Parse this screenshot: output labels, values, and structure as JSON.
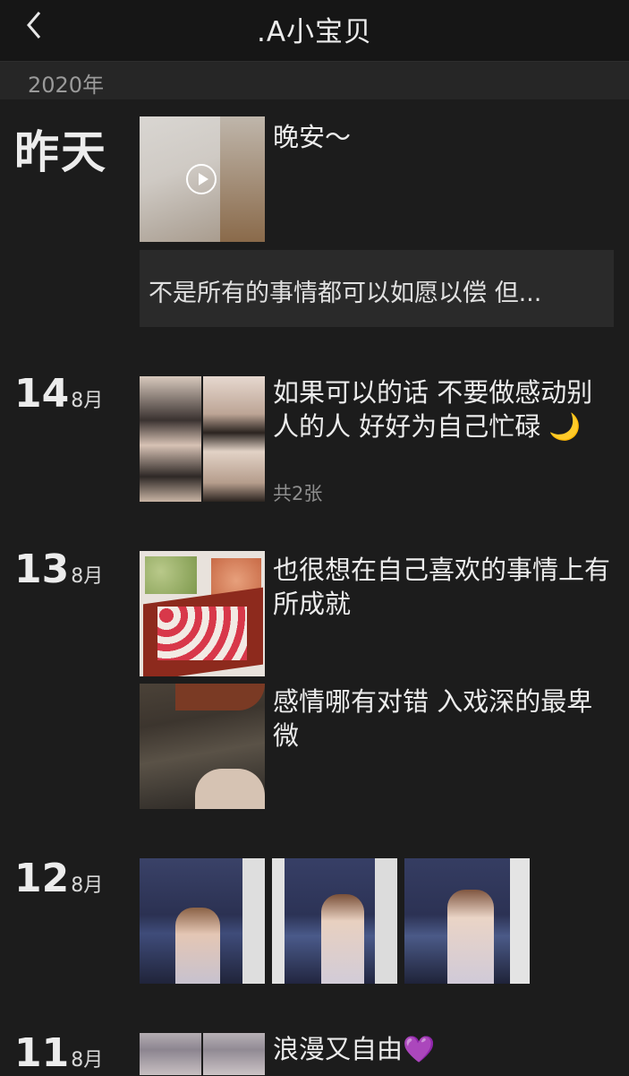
{
  "header": {
    "title": ".A小宝贝"
  },
  "year_label": "2020年",
  "posts": [
    {
      "date_label": "昨天",
      "text": "晚安～",
      "card_text": "不是所有的事情都可以如愿以偿  但..."
    },
    {
      "day": "14",
      "month": "8月",
      "text": "如果可以的话 不要做感动别人的人 好好为自己忙碌 🌙",
      "photo_count": "共2张"
    },
    {
      "day": "13",
      "month": "8月",
      "text": "也很想在自己喜欢的事情上有所成就",
      "text2": "感情哪有对错 入戏深的最卑微"
    },
    {
      "day": "12",
      "month": "8月"
    },
    {
      "day": "11",
      "month": "8月",
      "text": "浪漫又自由💜"
    }
  ]
}
